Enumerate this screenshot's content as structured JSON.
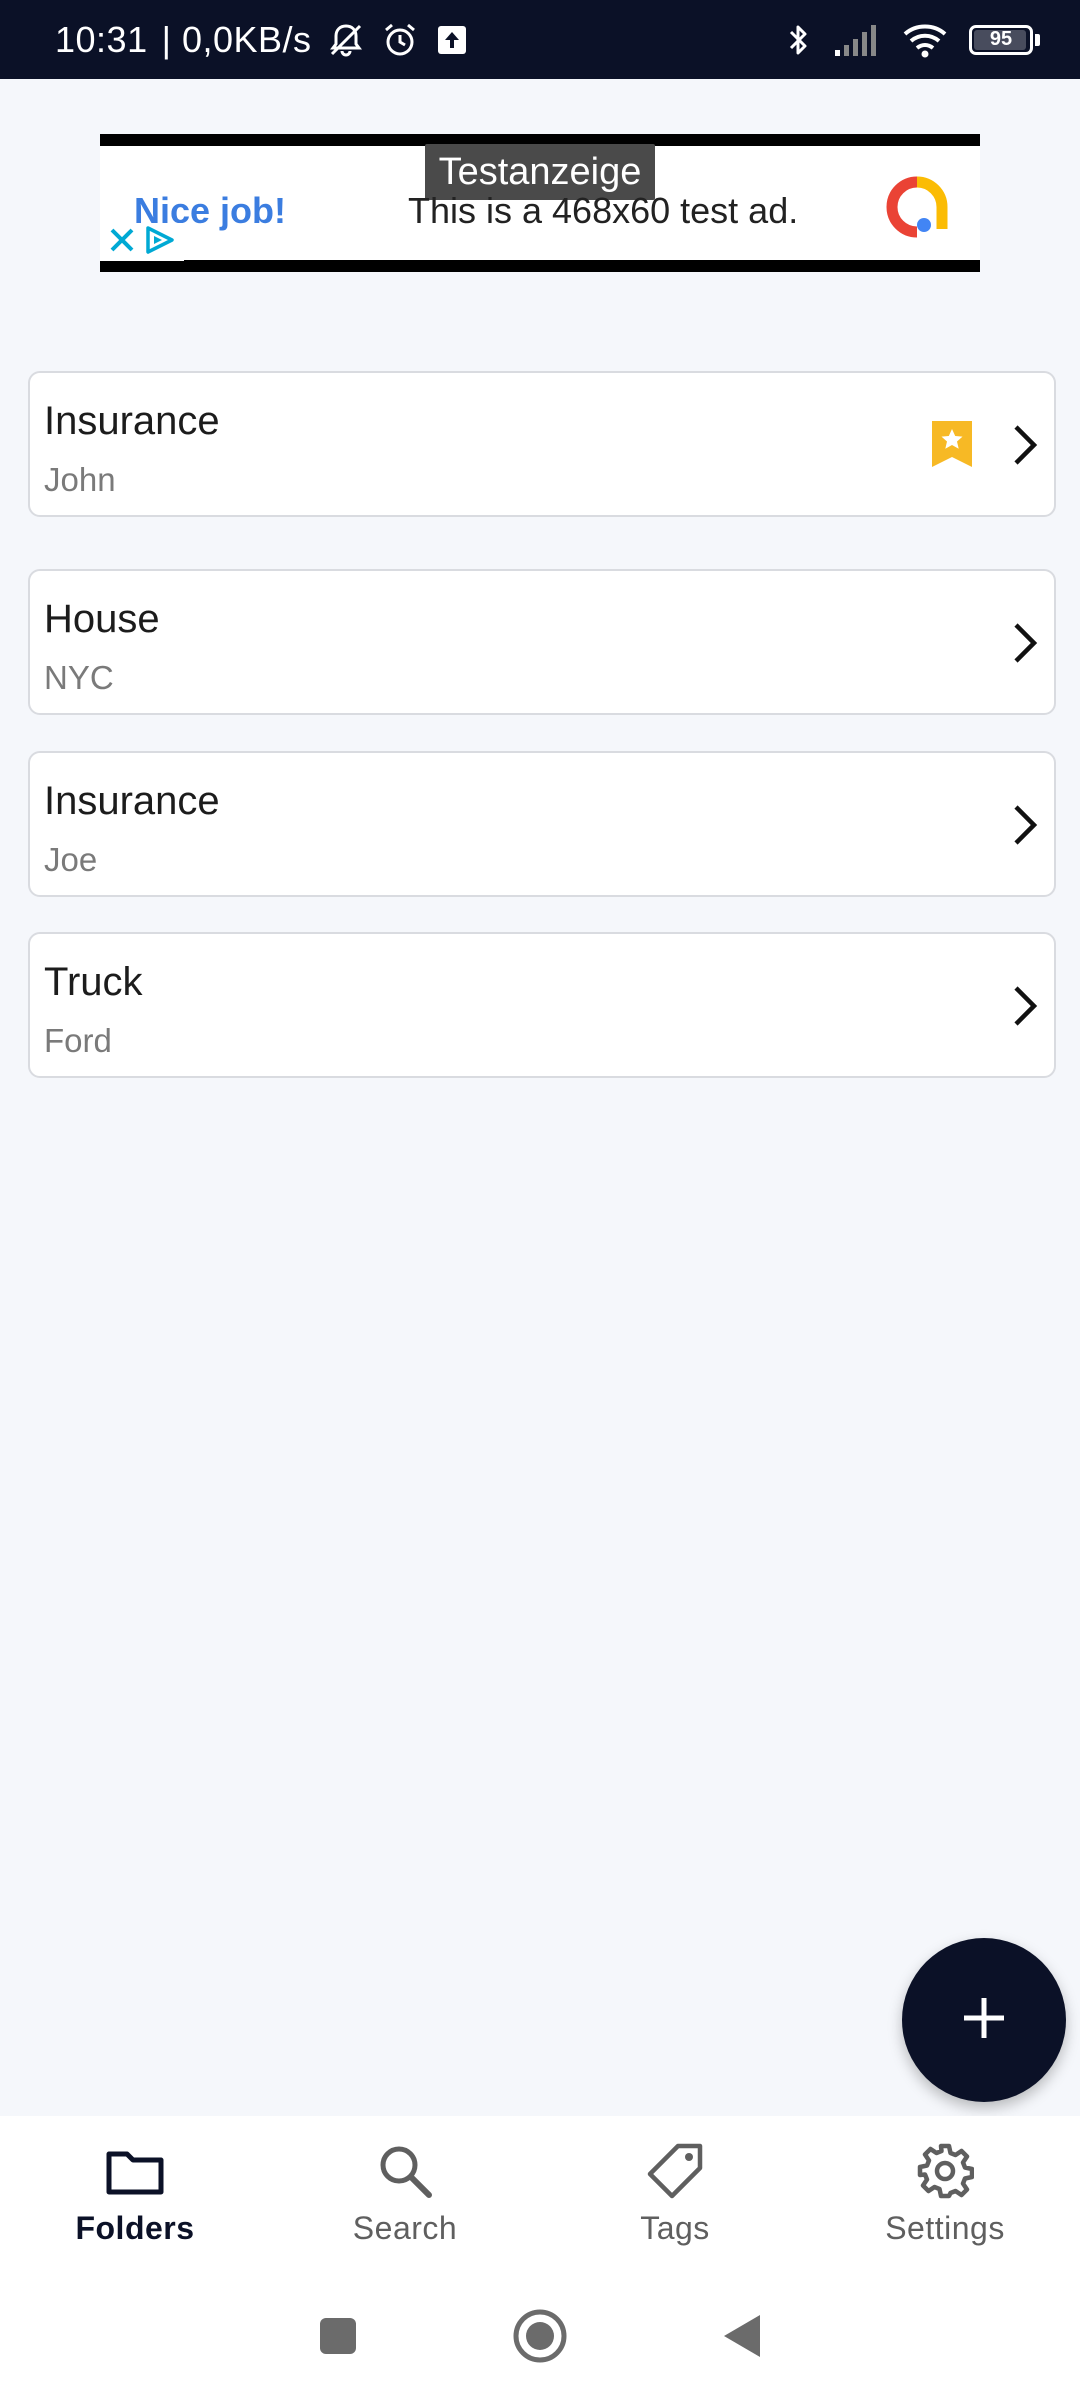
{
  "status_bar": {
    "time": "10:31",
    "network_speed": "| 0,0KB/s",
    "battery_level": "95",
    "icons": [
      "muted-notifications-icon",
      "alarm-icon",
      "upload-icon",
      "bluetooth-icon",
      "signal-icon",
      "wifi-icon",
      "battery-icon"
    ]
  },
  "ad": {
    "label": "Testanzeige",
    "headline": "Nice job!",
    "text": "This is a 468x60 test ad."
  },
  "folders": [
    {
      "title": "Insurance",
      "subtitle": "John",
      "favorite": true
    },
    {
      "title": "House",
      "subtitle": "NYC",
      "favorite": false
    },
    {
      "title": "Insurance",
      "subtitle": "Joe",
      "favorite": false
    },
    {
      "title": "Truck",
      "subtitle": "Ford",
      "favorite": false
    }
  ],
  "fab": {
    "icon": "plus-icon"
  },
  "bottom_nav": {
    "items": [
      {
        "label": "Folders",
        "icon": "folder-icon",
        "active": true
      },
      {
        "label": "Search",
        "icon": "search-icon",
        "active": false
      },
      {
        "label": "Tags",
        "icon": "tag-icon",
        "active": false
      },
      {
        "label": "Settings",
        "icon": "gear-icon",
        "active": false
      }
    ]
  },
  "system_nav": {
    "icons": [
      "recents-icon",
      "home-icon",
      "back-icon"
    ]
  },
  "colors": {
    "primary_dark": "#0b1127",
    "background": "#f5f7fb",
    "bookmark": "#f7b925",
    "ad_headline": "#3b7de0"
  }
}
